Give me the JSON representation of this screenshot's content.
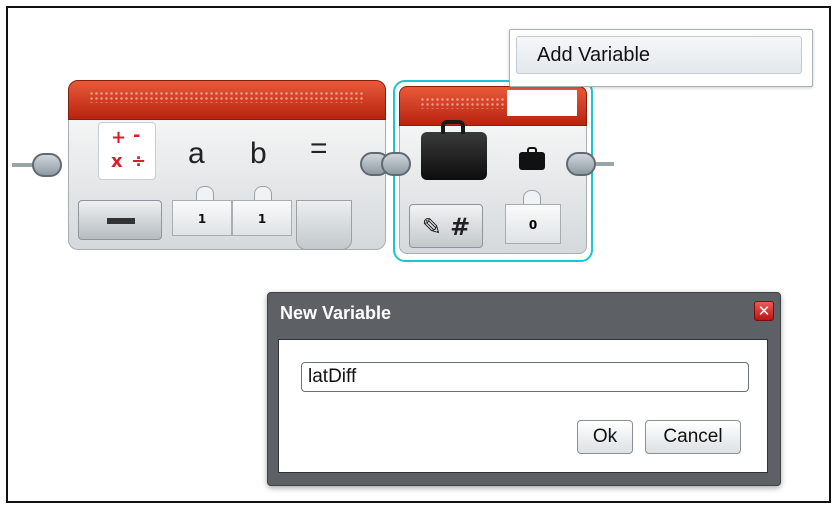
{
  "math_block": {
    "icon": "math-operations-icon",
    "ops": {
      "plus": "+",
      "minus": "-",
      "times": "x",
      "divide": "÷"
    },
    "inputs": [
      {
        "label": "a",
        "value": "1"
      },
      {
        "label": "b",
        "value": "1"
      }
    ],
    "output_label": "=",
    "mode_icon": "minus-icon",
    "header_color": "#c8321a"
  },
  "variable_block": {
    "icon": "briefcase-icon",
    "small_icon": "briefcase-small-icon",
    "mode_label": "✎ #",
    "value": "0",
    "highlight_color": "#19c6d3"
  },
  "name_menu": {
    "add_variable_label": "Add Variable"
  },
  "dialog": {
    "title": "New Variable",
    "close_icon": "close-icon",
    "input_value": "latDiff",
    "ok_label": "Ok",
    "cancel_label": "Cancel"
  }
}
